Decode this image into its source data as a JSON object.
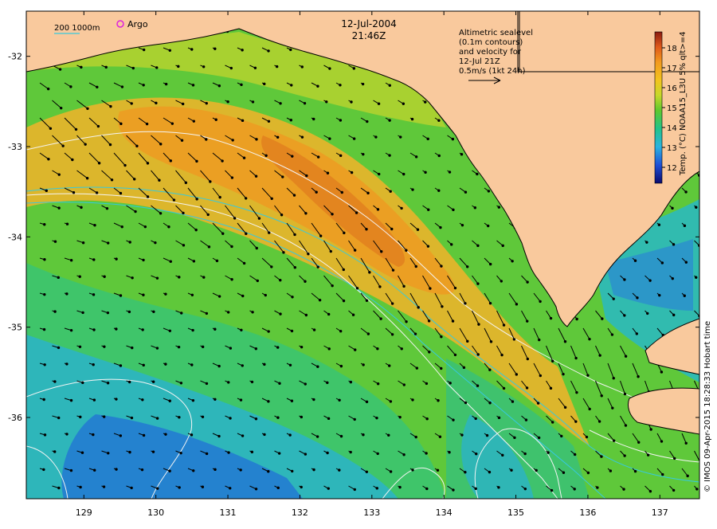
{
  "map": {
    "date": "12-Jul-2004",
    "time": "21:46Z",
    "bathymetry_legend": "200  1000m",
    "argo_label": "Argo",
    "altimetry_note": [
      "Altimetric sealevel",
      "(0.1m contours)",
      "and velocity for",
      "12-Jul 21Z",
      "0.5m/s (1kt 24h)"
    ],
    "credit": "© IMOS 09-Apr-2015 18:28:33 Hobart time",
    "colorbar": {
      "label": "Temp. (°C) NOAA15_L3U 5% qlt>=4",
      "ticks": [
        12,
        13,
        14,
        15,
        16,
        17,
        18
      ],
      "min": 11.2,
      "max": 18.8
    },
    "lon": {
      "min": 128.2,
      "max": 137.55,
      "ticks": [
        129,
        130,
        131,
        132,
        133,
        134,
        135,
        136,
        137
      ]
    },
    "lat": {
      "min": -36.9,
      "max": -31.5,
      "ticks": [
        -32,
        -33,
        -34,
        -35,
        -36
      ]
    }
  },
  "colors": {
    "land": "#f9c99d",
    "contour": "#f4f4f4",
    "bathy": "#37c9dd",
    "argo": "#dd22dd"
  }
}
